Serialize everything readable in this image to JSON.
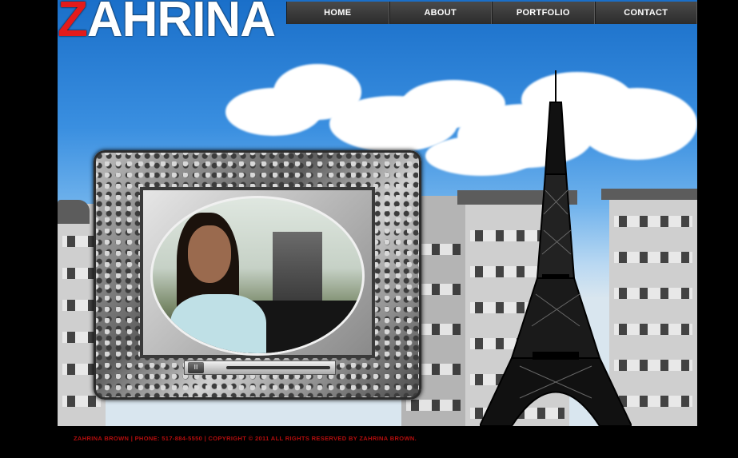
{
  "logo": {
    "first_letter": "Z",
    "rest": "AHRINA"
  },
  "nav": {
    "items": [
      {
        "label": "HOME"
      },
      {
        "label": "ABOUT"
      },
      {
        "label": "PORTFOLIO"
      },
      {
        "label": "CONTACT"
      }
    ]
  },
  "video": {
    "pause_icon": "pause-icon",
    "pause_glyph": "II"
  },
  "footer": {
    "text": "ZAHRINA BROWN | PHONE: 517-884-5550 | COPYRIGHT © 2011 ALL RIGHTS RESERVED BY ZAHRINA BROWN."
  },
  "colors": {
    "brand_red": "#e31b1b",
    "footer_red": "#b40d0d",
    "nav_bg": "#3a3a3a",
    "sky": "#3a8fe0"
  }
}
